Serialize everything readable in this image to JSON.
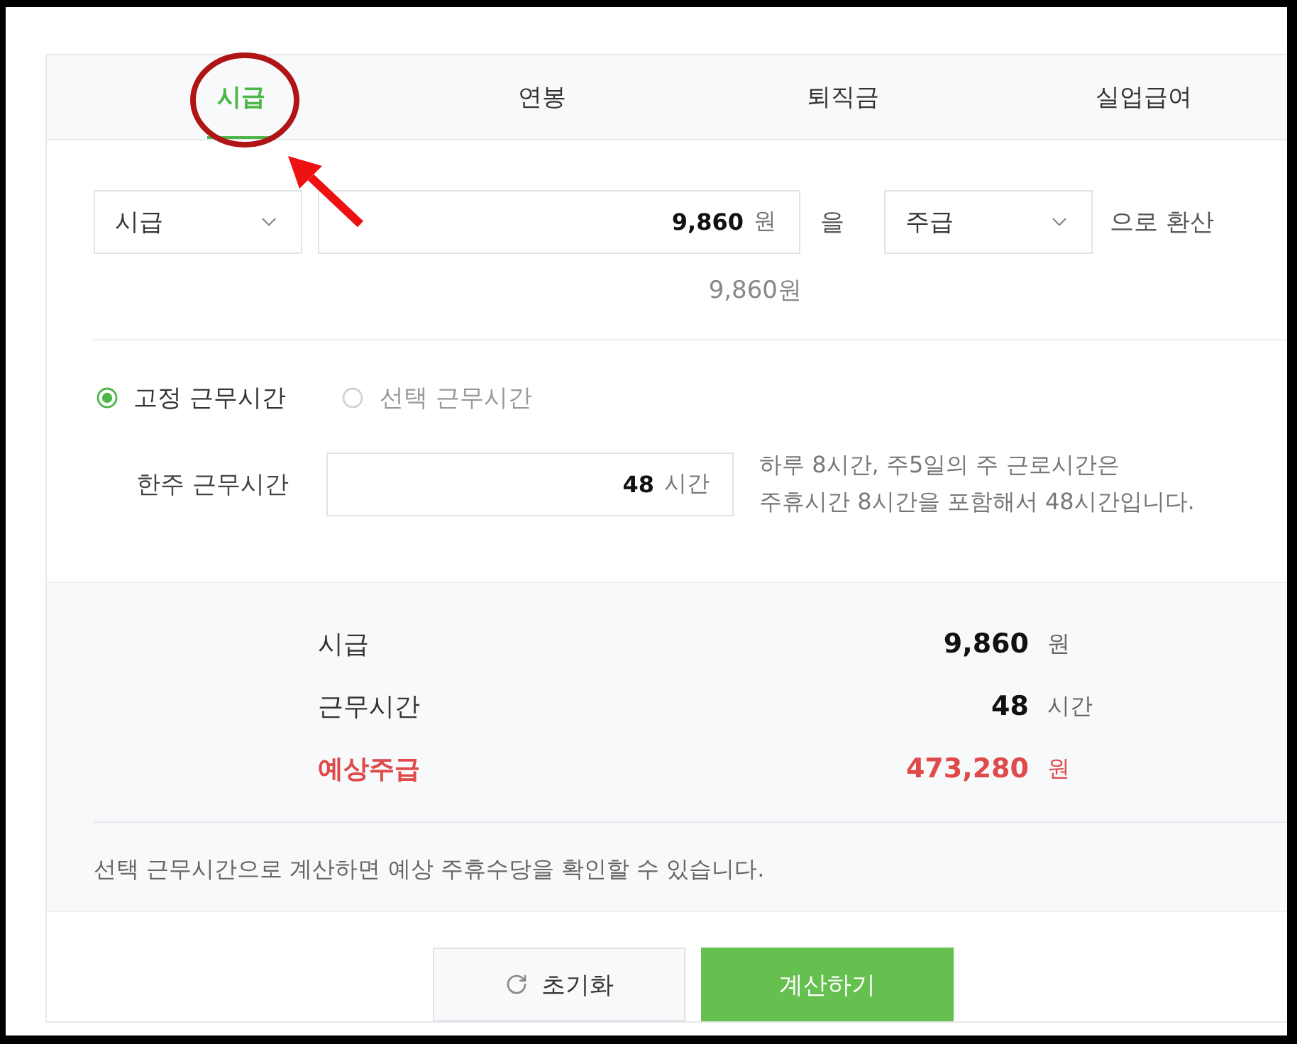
{
  "tabs": [
    {
      "label": "시급",
      "selected": true
    },
    {
      "label": "연봉",
      "selected": false
    },
    {
      "label": "퇴직금",
      "selected": false
    },
    {
      "label": "실업급여",
      "selected": false
    }
  ],
  "converter": {
    "from_unit": {
      "value": "시급"
    },
    "amount": {
      "value": "9,860",
      "unit": "원"
    },
    "particle": "을",
    "to_unit": {
      "value": "주급"
    },
    "suffix": "으로 환산",
    "preview": "9,860원"
  },
  "work_mode": [
    {
      "label": "고정 근무시간",
      "selected": true
    },
    {
      "label": "선택 근무시간",
      "selected": false
    }
  ],
  "weekly_hours": {
    "label": "한주 근무시간",
    "value": "48",
    "unit": "시간",
    "help_lines": [
      "하루 8시간, 주5일의 주 근로시간은",
      "주휴시간 8시간을 포함해서 48시간입니다."
    ]
  },
  "summary": {
    "rows": [
      {
        "label": "시급",
        "value": "9,860",
        "unit": "원",
        "emphasis": false
      },
      {
        "label": "근무시간",
        "value": "48",
        "unit": "시간",
        "emphasis": false
      },
      {
        "label": "예상주급",
        "value": "473,280",
        "unit": "원",
        "emphasis": true
      }
    ],
    "note": "선택 근무시간으로 계산하면 예상 주휴수당을 확인할 수 있습니다."
  },
  "buttons": [
    {
      "label": "초기화",
      "kind": "reset"
    },
    {
      "label": "계산하기",
      "kind": "primary"
    }
  ]
}
